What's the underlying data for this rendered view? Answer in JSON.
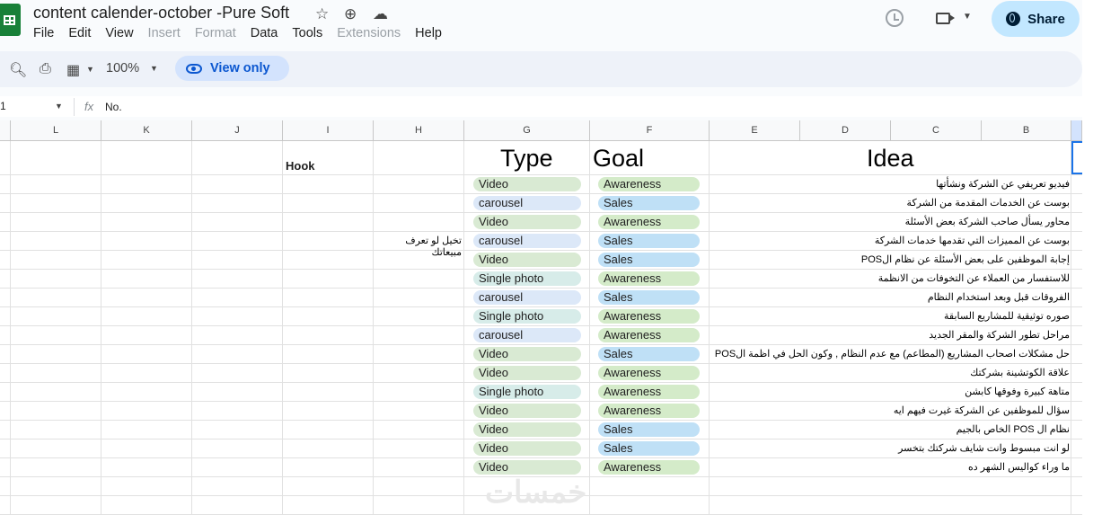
{
  "title": "content calender-october -Pure Soft",
  "menu": [
    "File",
    "Edit",
    "View",
    "Insert",
    "Format",
    "Data",
    "Tools",
    "Extensions",
    "Help"
  ],
  "menu_disabled": [
    "Insert",
    "Format",
    "Extensions"
  ],
  "share_label": "Share",
  "zoom": "100%",
  "view_only_label": "View only",
  "namebox": "1",
  "fx_label": "fx",
  "formula": "No.",
  "columns": [
    "L",
    "K",
    "J",
    "I",
    "H",
    "G",
    "F",
    "E",
    "D",
    "C",
    "B"
  ],
  "headers": {
    "hook": "Hook",
    "type": "Type",
    "goal": "Goal",
    "idea": "Idea"
  },
  "rows": [
    {
      "idea": "فيديو تعريفي عن الشركة ونشأتها",
      "type": "Video",
      "goal": "Awareness",
      "hook": ""
    },
    {
      "idea": "بوست عن الخدمات المقدمة من الشركة",
      "type": "carousel",
      "goal": "Sales",
      "hook": ""
    },
    {
      "idea": "محاور يسأل صاحب الشركة بعض الأسئلة",
      "type": "Video",
      "goal": "Awareness",
      "hook": ""
    },
    {
      "idea": "بوست عن المميزات التي تقدمها خدمات الشركة",
      "type": "carousel",
      "goal": "Sales",
      "hook": "تخيل لو تعرف مبيعاتك"
    },
    {
      "idea": "إجابة الموظفين على بعض الأسئلة عن نظام الPOS",
      "type": "Video",
      "goal": "Sales",
      "hook": ""
    },
    {
      "idea": "للاستفسار من العملاء عن التخوفات من الانظمة",
      "type": "Single photo",
      "goal": "Awareness",
      "hook": ""
    },
    {
      "idea": "الفروقات قبل وبعد استخدام النظام",
      "type": "carousel",
      "goal": "Sales",
      "hook": ""
    },
    {
      "idea": "صوره توثيقية للمشاريع السابقة",
      "type": "Single photo",
      "goal": "Awareness",
      "hook": ""
    },
    {
      "idea": "مراحل تطور الشركة والمقر الجديد",
      "type": "carousel",
      "goal": "Awareness",
      "hook": ""
    },
    {
      "idea": "حل مشكلات اصحاب المشاريع (المطاعم) مع عدم النظام , وكون الحل في اظمة الPOS",
      "type": "Video",
      "goal": "Sales",
      "hook": ""
    },
    {
      "idea": "علاقة الكوتشينة بشركتك",
      "type": "Video",
      "goal": "Awareness",
      "hook": ""
    },
    {
      "idea": "متاهة كبيرة وفوقها كابشن",
      "type": "Single photo",
      "goal": "Awareness",
      "hook": ""
    },
    {
      "idea": "سؤال للموظفين عن الشركة غيرت فيهم ايه",
      "type": "Video",
      "goal": "Awareness",
      "hook": ""
    },
    {
      "idea": "نظام ال POS الخاص بالجيم",
      "type": "Video",
      "goal": "Sales",
      "hook": ""
    },
    {
      "idea": "لو انت مبسوط وانت شايف شركتك بتخسر",
      "type": "Video",
      "goal": "Sales",
      "hook": ""
    },
    {
      "idea": "ما وراء كواليس الشهر ده",
      "type": "Video",
      "goal": "Awareness",
      "hook": ""
    }
  ],
  "colors": {
    "video": "#d9ead3",
    "carousel": "#dce8f8",
    "single_photo": "#d7ece9",
    "awareness": "#d4ebc9",
    "sales": "#bfe0f6",
    "share_bg": "#c2e7ff",
    "sheets_green": "#188038"
  },
  "watermark": "خمسات"
}
